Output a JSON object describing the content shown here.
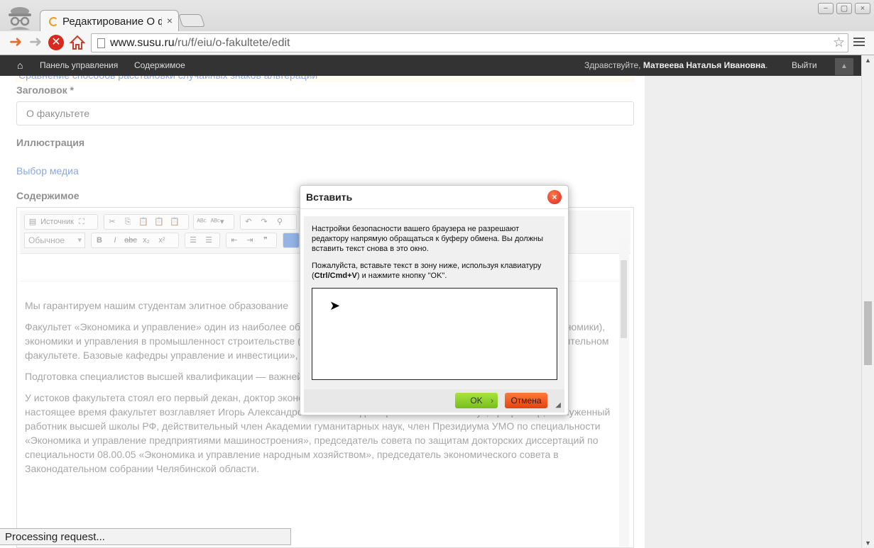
{
  "browser": {
    "tab_title": "Редактирование О ф",
    "tab_close": "×",
    "url_host": "www.susu.ru",
    "url_path": "/ru/f/eiu/o-fakultete/edit",
    "window_controls": [
      "−",
      "▢",
      "×"
    ]
  },
  "admin_bar": {
    "dashboard": "Панель управления",
    "content": "Содержимое",
    "greeting": "Здравствуйте, ",
    "user": "Матвеева Наталья Ивановна",
    "greeting_end": ".",
    "logout": "Выйти"
  },
  "form": {
    "prev_link": "Сравнение способов расстановки случайных знаков альтерации",
    "title_label": "Заголовок *",
    "title_value": "О факультете",
    "illustration_label": "Иллюстрация",
    "media_link": "Выбор медиа",
    "content_label": "Содержимое"
  },
  "editor": {
    "source_label": "Источник",
    "format_value": "Обычное",
    "paragraphs": [
      "Мы гарантируем нашим студентам элитное образование",
      "Факультет «Экономика и управление» один из наиболее образовался в 1992 году, объединив несколько кафедр: экономики), экономики и управления в промышленност строительстве (ныне экономики, управления и инвестиц на приборостроительном факультете. Базовые кафедры управление и инвестиции», «Экономическая теория, ми основания университета.",
      "Подготовка специалистов высшей квалификации — важнейшая задача факультета.",
      "У истоков факультета стоял его первый декан, доктор экономических наук, профессор Александр Кузьмич Тащев. В настоящее время факультет возглавляет Игорь Александрович Баев — доктор экономических наук, профессор, заслуженный работник высшей школы РФ, действительный член Академии гуманитарных наук, член Президиума УМО по специальности «Экономика и управление предприятиями машиностроения», председатель совета по защитам докторских диссертаций по специальности 08.00.05 «Экономика и управление народным хозяйством», председатель экономического совета в Законодательном собрании Челябинской области."
    ],
    "behind_dialog_fragments": [
      "ой",
      "ния в",
      "ента"
    ]
  },
  "dialog": {
    "title": "Вставить",
    "close": "×",
    "message1": "Настройки безопасности вашего браузера не разрешают редактору напрямую обращаться к буферу обмена. Вы должны вставить текст снова в это окно.",
    "message2_pre": "Пожалуйста, вставьте текст в зону ниже, используя клавиатуру (",
    "message2_keys": "Ctrl/Cmd+V",
    "message2_post": ") и нажмите кнопку \"OK\".",
    "ok": "OK",
    "cancel": "Отмена"
  },
  "status": "Processing request..."
}
